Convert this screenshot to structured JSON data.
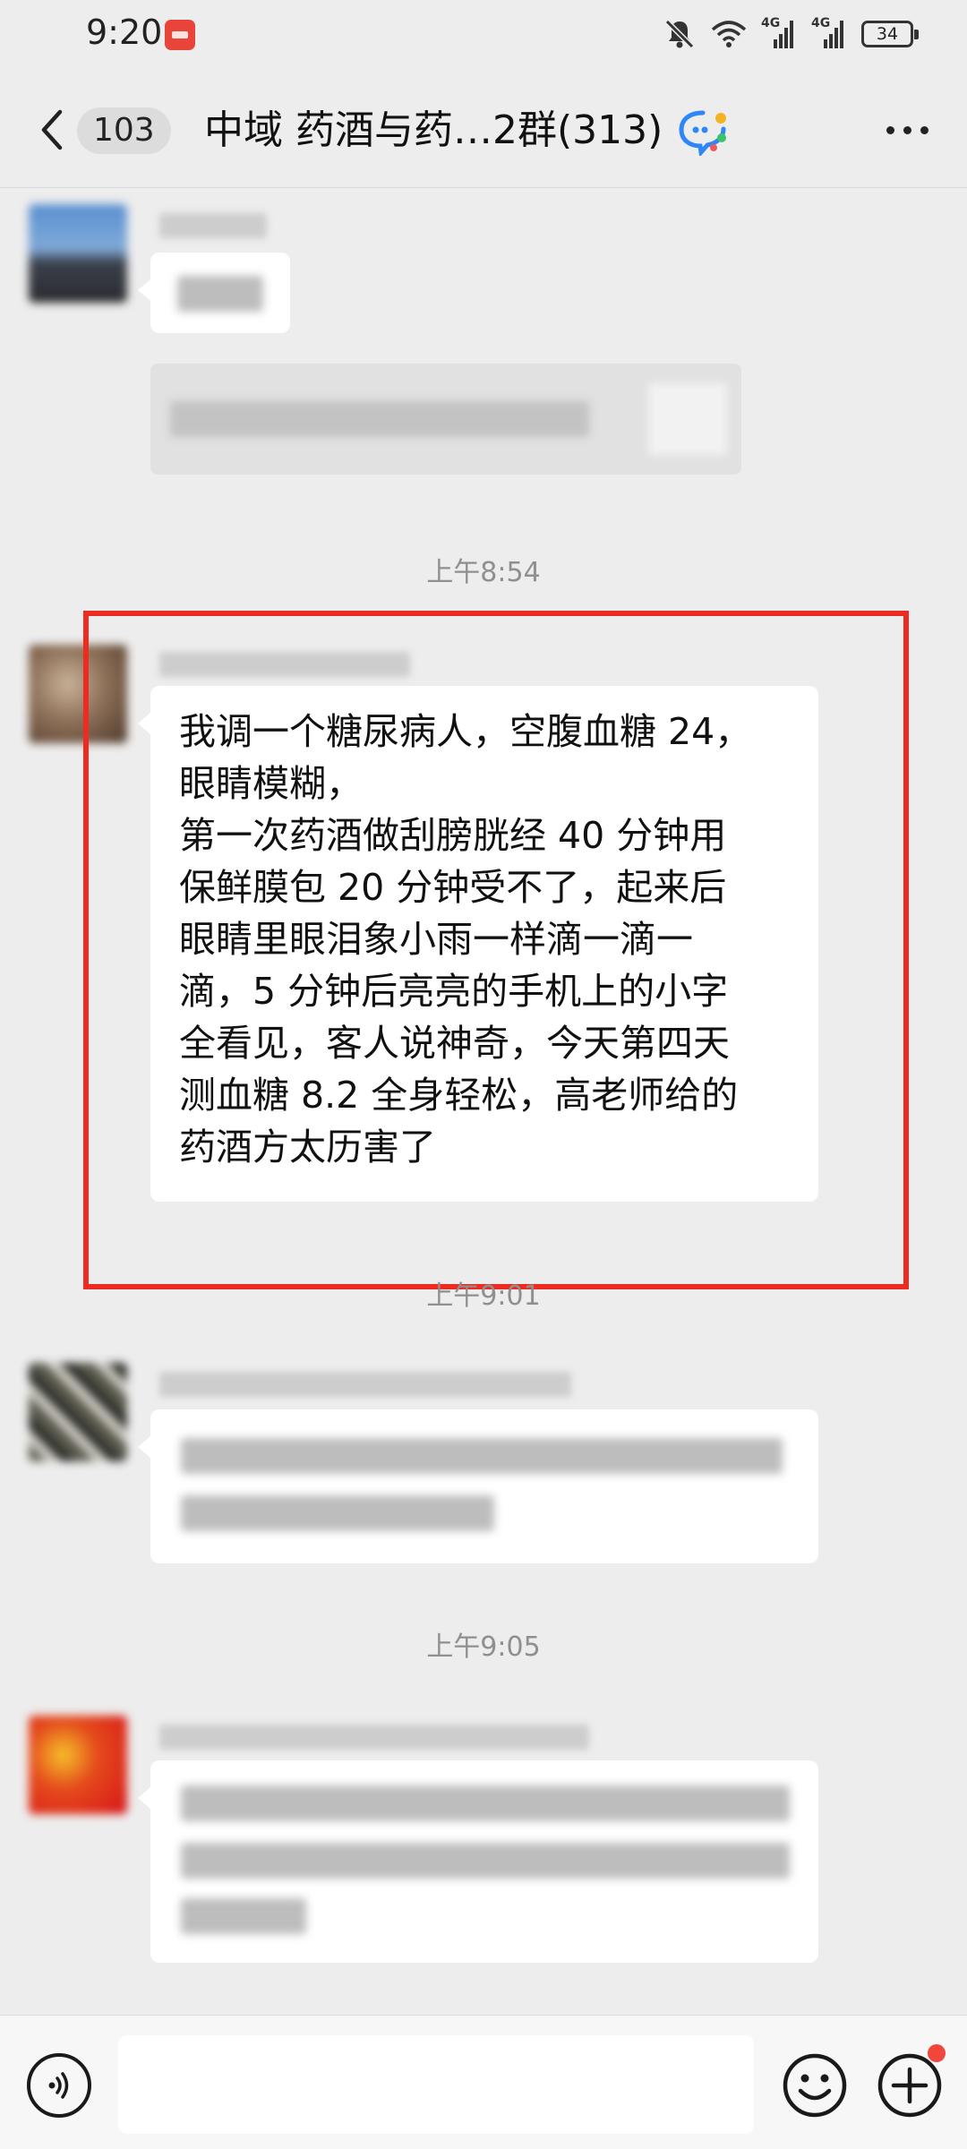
{
  "status_bar": {
    "time": "9:20",
    "network_1": "4G",
    "network_2": "4G",
    "battery": "34",
    "icons": [
      "huawei-app-icon",
      "mute-bell-icon",
      "wifi-icon",
      "signal-icon",
      "signal-icon",
      "battery-icon"
    ]
  },
  "header": {
    "back_icon": "chevron-left-icon",
    "unread_count": "103",
    "title": "中域 药酒与药…2群(313)",
    "group_icon": "group-chat-icon",
    "more_icon": "more-dots-icon"
  },
  "messages": {
    "time_854": "上午8:54",
    "time_901": "上午9:01",
    "time_905": "上午9:05",
    "highlighted_message": "我调一个糖尿病人，空腹血糖 24，\n眼睛模糊，\n第一次药酒做刮膀胱经 40 分钟用\n保鲜膜包 20 分钟受不了，起来后\n眼睛里眼泪象小雨一样滴一滴一\n滴，5 分钟后亮亮的手机上的小字\n全看见，客人说神奇，今天第四天\n测血糖 8.2 全身轻松，高老师给的\n药酒方太历害了",
    "highlight_color": "#ec2b23"
  },
  "input_bar": {
    "voice_icon": "voice-icon",
    "input_placeholder": "",
    "emoji_icon": "emoji-icon",
    "plus_icon": "plus-icon"
  }
}
